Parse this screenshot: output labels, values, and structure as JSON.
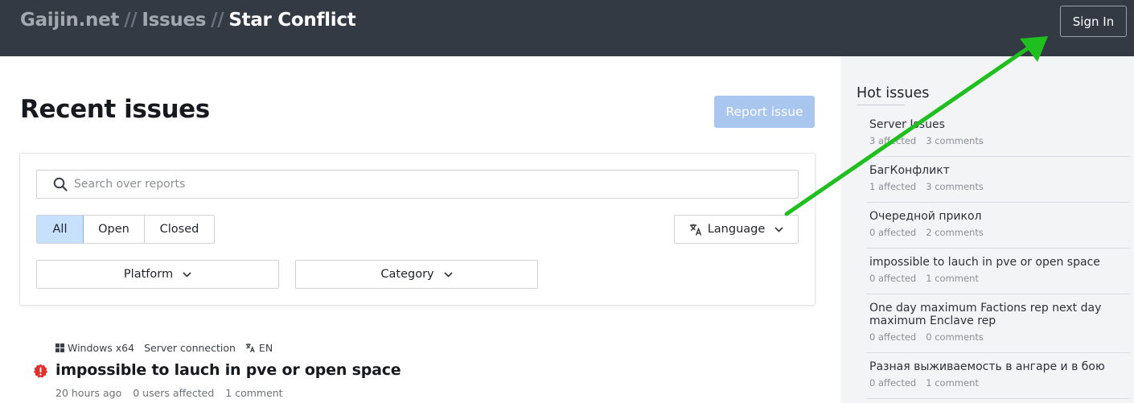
{
  "header": {
    "crumbs": [
      "Gaijin.net",
      "Issues",
      "Star Conflict"
    ],
    "separator": "//",
    "sign_in": "Sign In"
  },
  "main": {
    "title": "Recent issues",
    "report_button": "Report issue",
    "search": {
      "placeholder": "Search over reports",
      "value": ""
    },
    "status_tabs": [
      "All",
      "Open",
      "Closed"
    ],
    "active_tab": "All",
    "language_label": "Language",
    "platform_label": "Platform",
    "category_label": "Category"
  },
  "issue": {
    "platform": "Windows x64",
    "category": "Server connection",
    "language": "EN",
    "title": "impossible to lauch in pve or open space",
    "time": "20 hours ago",
    "affected": "0 users affected",
    "comments": "1 comment"
  },
  "sidebar": {
    "title": "Hot issues",
    "items": [
      {
        "title": "Server Issues",
        "affected": "3 affected",
        "comments": "3 comments"
      },
      {
        "title": "БагКонфликт",
        "affected": "1 affected",
        "comments": "3 comments"
      },
      {
        "title": "Очередной прикол",
        "affected": "0 affected",
        "comments": "2 comments"
      },
      {
        "title": "impossible to lauch in pve or open space",
        "affected": "0 affected",
        "comments": "1 comment"
      },
      {
        "title": "One day maximum Factions rep next day maximum Enclave rep",
        "affected": "0 affected",
        "comments": "0 comments"
      },
      {
        "title": "Разная выживаемость в ангаре и в бою",
        "affected": "0 affected",
        "comments": "1 comment"
      }
    ]
  },
  "colors": {
    "header_bg": "#343a44",
    "report_button": "#a8c6ee",
    "active_tab": "#c7e0fb",
    "alert_red": "#e0312f",
    "annotation_arrow": "#1fbf1f"
  },
  "icons": [
    "search-icon",
    "translate-icon",
    "chevron-down-icon",
    "windows-icon",
    "alert-icon"
  ]
}
